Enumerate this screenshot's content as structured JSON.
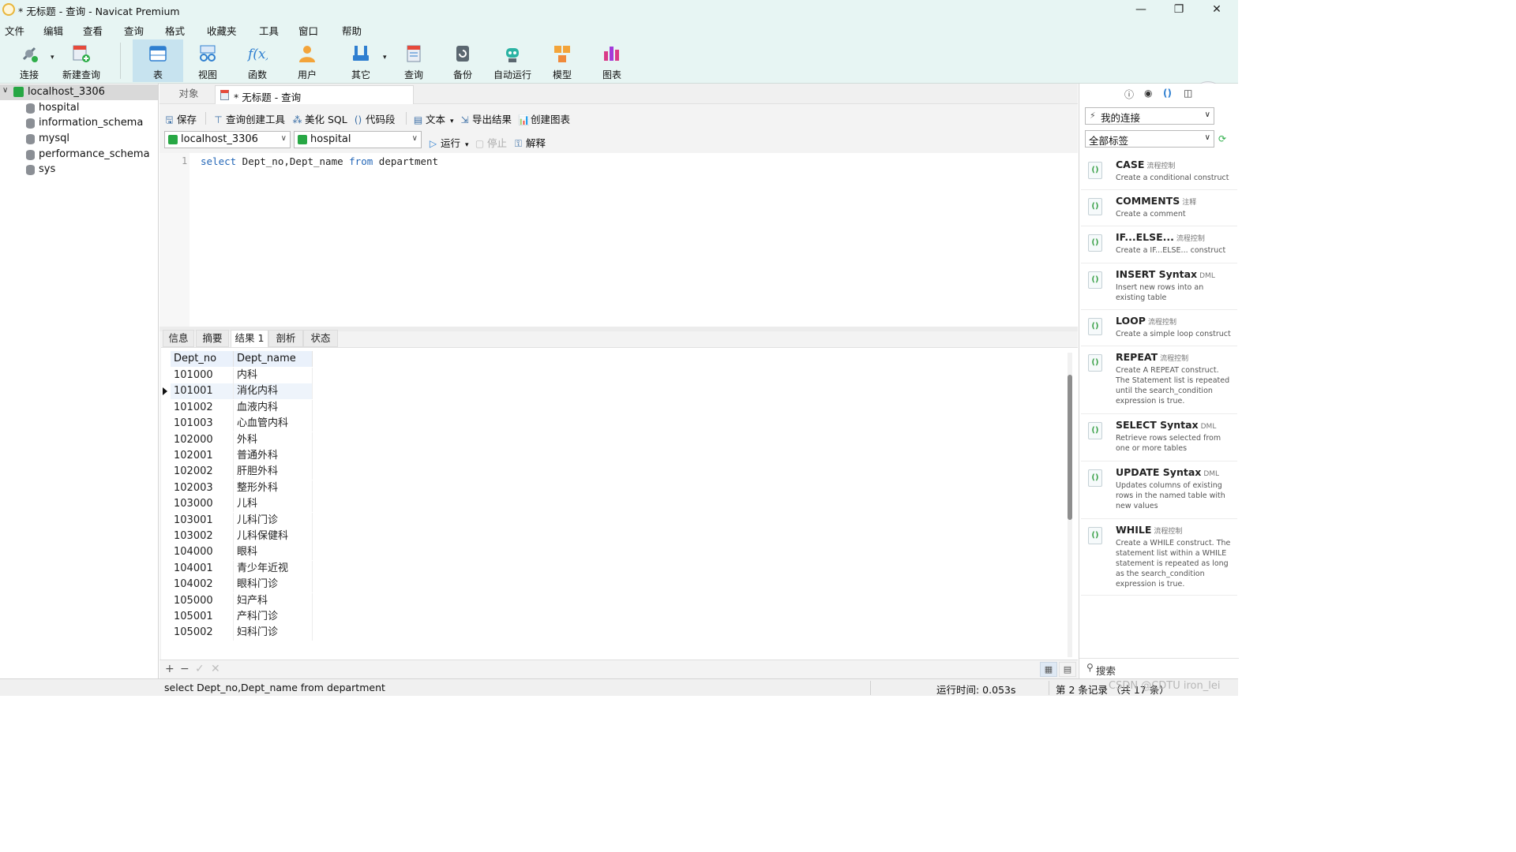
{
  "window": {
    "title": "* 无标题 - 查询 - Navicat Premium",
    "minimize": "—",
    "restore": "❐",
    "close": "✕"
  },
  "menu": [
    "文件",
    "编辑",
    "查看",
    "查询",
    "格式",
    "收藏夹",
    "工具",
    "窗口",
    "帮助"
  ],
  "toolbar": {
    "connect": "连接",
    "new_query": "新建查询",
    "table": "表",
    "view": "视图",
    "function": "函数",
    "user": "用户",
    "other": "其它",
    "query": "查询",
    "backup": "备份",
    "automation": "自动运行",
    "model": "模型",
    "chart": "图表",
    "active_item": "表"
  },
  "sidebar": {
    "connection": "localhost_3306",
    "databases": [
      "hospital",
      "information_schema",
      "mysql",
      "performance_schema",
      "sys"
    ]
  },
  "tabs": {
    "objects": "对象",
    "query_tab": "* 无标题 - 查询"
  },
  "query_toolbar": {
    "save": "保存",
    "builder": "查询创建工具",
    "beautify": "美化 SQL",
    "snippet": "代码段",
    "text": "文本",
    "export": "导出结果",
    "create_chart": "创建图表",
    "run": "运行",
    "stop": "停止",
    "explain": "解释"
  },
  "selectors": {
    "connection": "localhost_3306",
    "database": "hospital"
  },
  "editor": {
    "line_number": "1",
    "kw_select": "select",
    "columns": " Dept_no,Dept_name ",
    "kw_from": "from",
    "table": " department"
  },
  "result_tabs": [
    "信息",
    "摘要",
    "结果 1",
    "剖析",
    "状态"
  ],
  "result_active_tab": "结果 1",
  "grid": {
    "columns": [
      "Dept_no",
      "Dept_name"
    ],
    "selected_row": 1,
    "rows": [
      [
        "101000",
        "内科"
      ],
      [
        "101001",
        "消化内科"
      ],
      [
        "101002",
        "血液内科"
      ],
      [
        "101003",
        "心血管内科"
      ],
      [
        "102000",
        "外科"
      ],
      [
        "102001",
        "普通外科"
      ],
      [
        "102002",
        "肝胆外科"
      ],
      [
        "102003",
        "整形外科"
      ],
      [
        "103000",
        "儿科"
      ],
      [
        "103001",
        "儿科门诊"
      ],
      [
        "103002",
        "儿科保健科"
      ],
      [
        "104000",
        "眼科"
      ],
      [
        "104001",
        "青少年近视"
      ],
      [
        "104002",
        "眼科门诊"
      ],
      [
        "105000",
        "妇产科"
      ],
      [
        "105001",
        "产科门诊"
      ],
      [
        "105002",
        "妇科门诊"
      ]
    ]
  },
  "grid_footer": {
    "add": "+",
    "remove": "−",
    "apply": "✓",
    "discard": "✕"
  },
  "right_panel": {
    "connection_combo": "我的连接",
    "tag_combo": "全部标签",
    "search_label": "搜索",
    "snippets": [
      {
        "name": "CASE",
        "tag": "流程控制",
        "desc": "Create a conditional construct"
      },
      {
        "name": "COMMENTS",
        "tag": "注释",
        "desc": "Create a comment"
      },
      {
        "name": "IF...ELSE...",
        "tag": "流程控制",
        "desc": "Create a IF...ELSE... construct"
      },
      {
        "name": "INSERT Syntax",
        "tag": "DML",
        "desc": "Insert new rows into an existing table"
      },
      {
        "name": "LOOP",
        "tag": "流程控制",
        "desc": "Create a simple loop construct"
      },
      {
        "name": "REPEAT",
        "tag": "流程控制",
        "desc": "Create A REPEAT construct. The Statement list is repeated until the search_condition expression is true."
      },
      {
        "name": "SELECT Syntax",
        "tag": "DML",
        "desc": "Retrieve rows selected from one or more tables"
      },
      {
        "name": "UPDATE Syntax",
        "tag": "DML",
        "desc": "Updates columns of existing rows in the named table with new values"
      },
      {
        "name": "WHILE",
        "tag": "流程控制",
        "desc": "Create a WHILE construct. The statement list within a WHILE statement is repeated as long as the search_condition expression is true."
      }
    ]
  },
  "status": {
    "sql": "select Dept_no,Dept_name from department",
    "runtime": "运行时间: 0.053s",
    "record": "第 2 条记录 （共 17 条）"
  },
  "watermark": "CSDN @CDTU iron_lei",
  "colors": {
    "chrome_bg": "#e7f5f3",
    "active_tool": "#c7e3ef",
    "keyword": "#2366b7",
    "connection_green": "#27a744"
  }
}
